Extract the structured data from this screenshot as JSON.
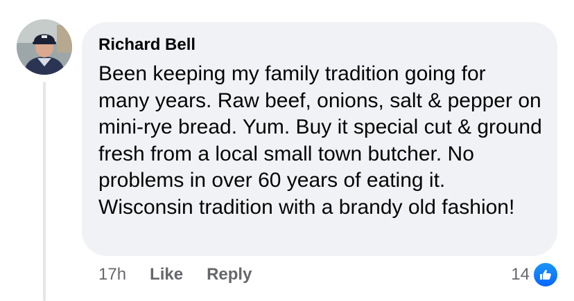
{
  "comment": {
    "author": "Richard Bell",
    "text": "Been keeping my family tradition going for many years. Raw beef, onions, salt & pepper on mini-rye bread. Yum. Buy it special cut & ground fresh from a local small town butcher. No problems in over 60 years of eating it. Wisconsin tradition with a brandy old fashion!",
    "timestamp": "17h",
    "like_label": "Like",
    "reply_label": "Reply",
    "reaction_count": "14",
    "reaction_icon": "thumbs-up-icon"
  },
  "colors": {
    "bubble": "#f0f2f5",
    "text": "#050505",
    "secondary_text": "#65676b",
    "like_blue": "#0866ff",
    "thread_line": "#e4e6eb"
  }
}
